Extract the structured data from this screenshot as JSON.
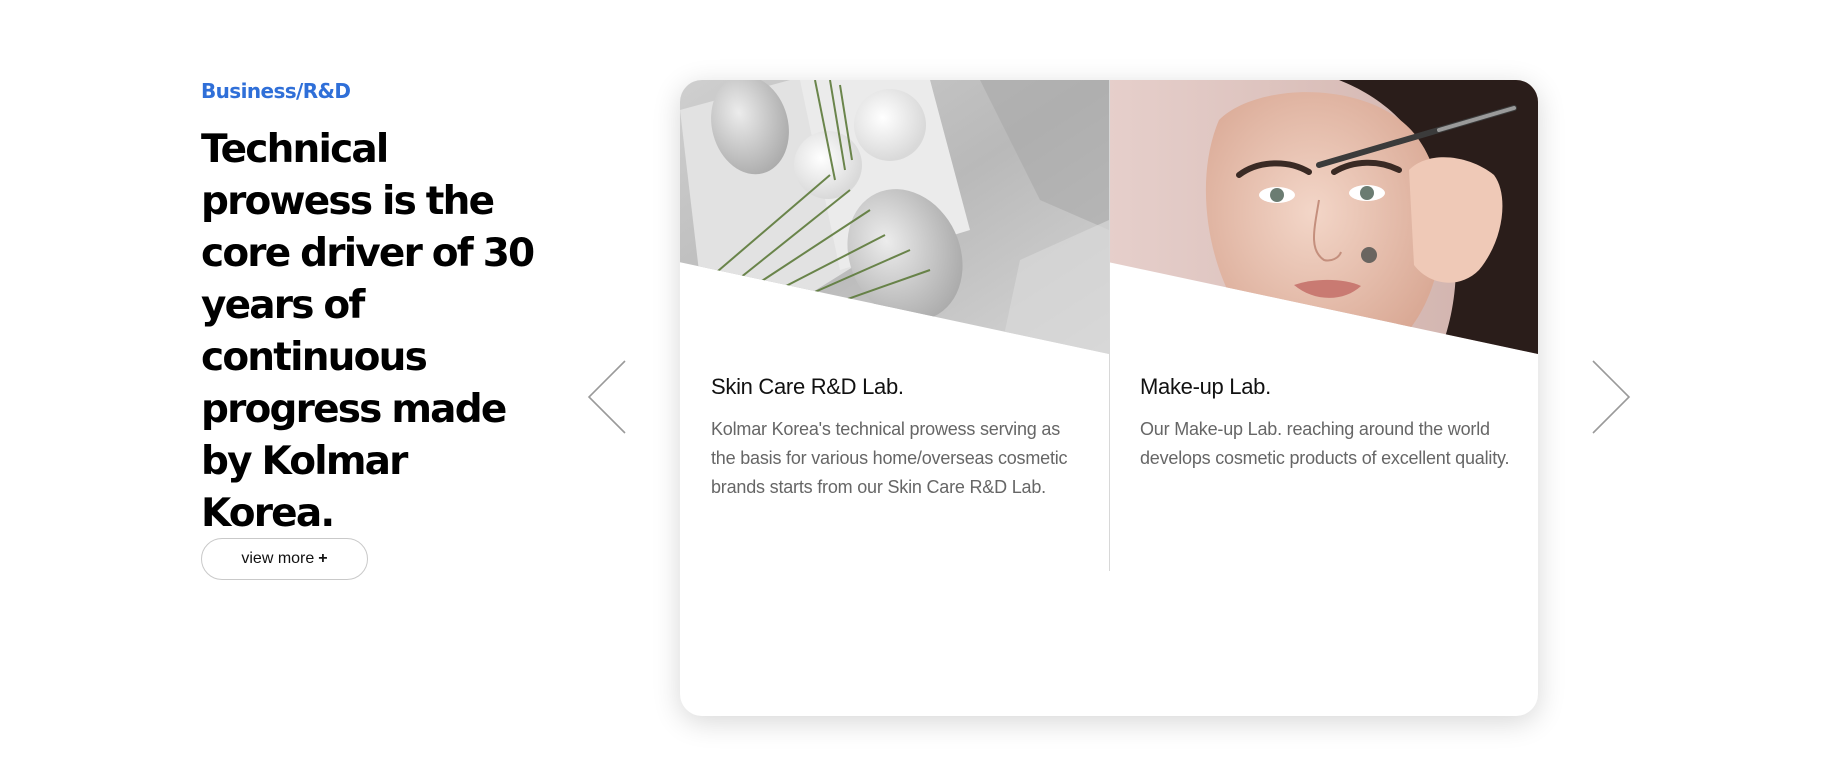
{
  "section": {
    "eyebrow": "Business/R&D",
    "headline": "Technical prowess is the core driver of 30 years of continuous progress made by Kolmar Korea.",
    "view_more_label": "view more",
    "view_more_icon": "+"
  },
  "colors": {
    "accent": "#2f6fd8",
    "headline": "#000000",
    "card_desc": "#666666"
  },
  "slider": {
    "prev_icon": "chevron-left-icon",
    "next_icon": "chevron-right-icon"
  },
  "cards": [
    {
      "title": "Skin Care R&D Lab.",
      "description": "Kolmar Korea's technical prowess serving as the basis for various home/overseas cosmetic brands starts from our Skin Care R&D Lab."
    },
    {
      "title": "Make-up Lab.",
      "description": "Our Make-up Lab. reaching around the world develops cosmetic products of excellent quality."
    }
  ]
}
